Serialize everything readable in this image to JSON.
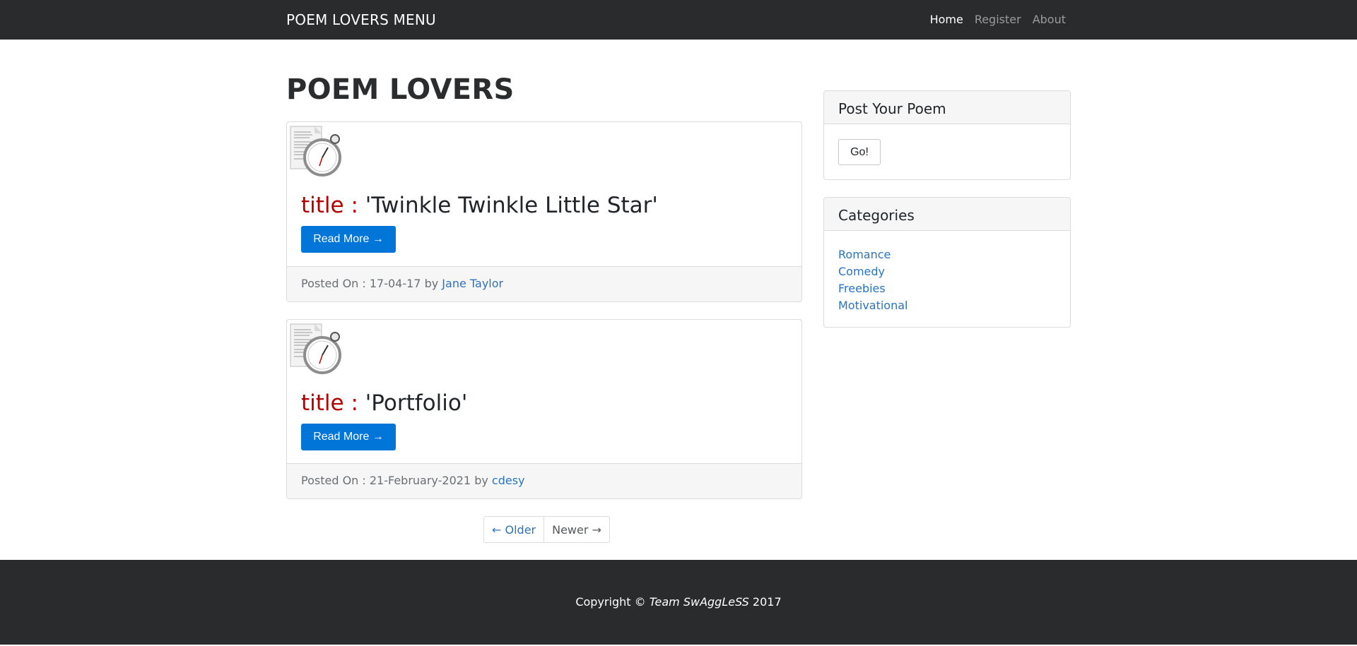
{
  "navbar": {
    "brand": "POEM LOVERS MENU",
    "links": [
      {
        "label": "Home",
        "active": true
      },
      {
        "label": "Register",
        "active": false
      },
      {
        "label": "About",
        "active": false
      }
    ]
  },
  "main": {
    "page_title": "POEM LOVERS",
    "posts": [
      {
        "title_label": "title :",
        "title": "'Twinkle Twinkle Little Star'",
        "read_more": "Read More →",
        "posted_prefix": "Posted On : 17-04-17 by",
        "author": "Jane Taylor",
        "thumb_icon": "document-stopwatch-icon"
      },
      {
        "title_label": "title :",
        "title": "'Portfolio'",
        "read_more": "Read More →",
        "posted_prefix": "Posted On : 21-February-2021 by",
        "author": "cdesy",
        "thumb_icon": "document-stopwatch-icon"
      }
    ],
    "pager": {
      "older": "← Older",
      "newer": "Newer →"
    }
  },
  "sidebar": {
    "post_widget": {
      "title": "Post Your Poem",
      "button": "Go!"
    },
    "categories_widget": {
      "title": "Categories",
      "items": [
        "Romance",
        "Comedy",
        "Freebies",
        "Motivational"
      ]
    }
  },
  "footer": {
    "copyright_prefix": "Copyright ©",
    "team": "Team SwAggLeSS",
    "year": "2017"
  },
  "colors": {
    "navbar_bg": "#2a2b2d",
    "primary_button": "#0275d8",
    "link": "#2a74c0",
    "title_label": "#b30000"
  }
}
